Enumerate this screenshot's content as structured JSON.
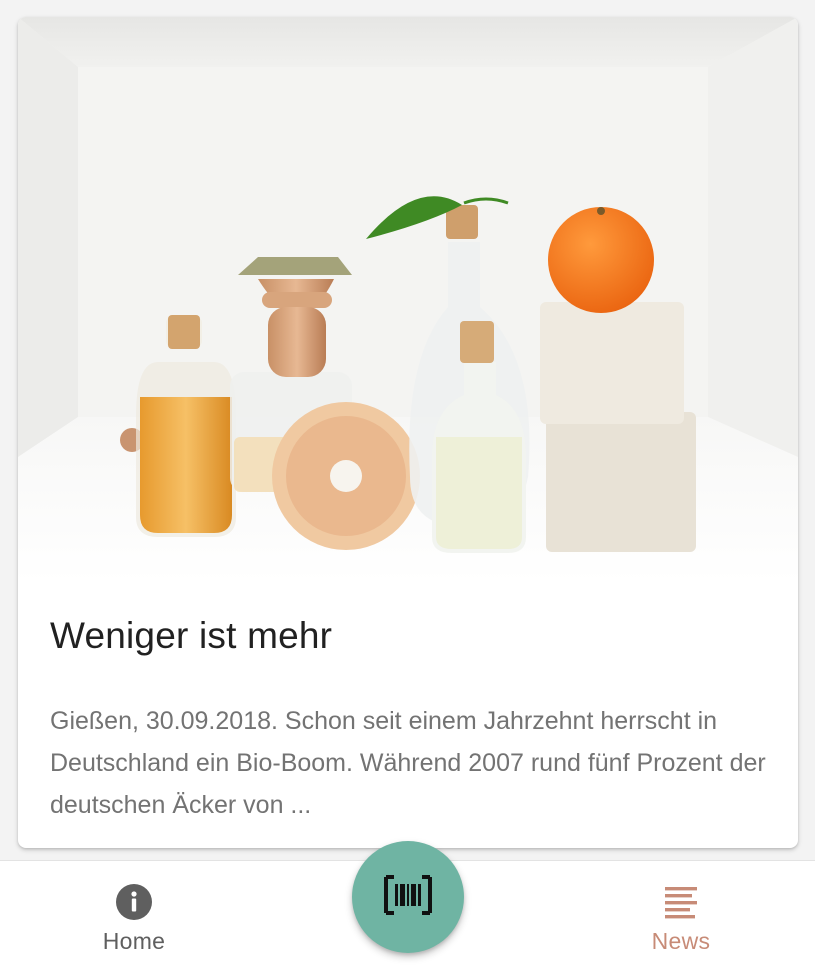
{
  "article": {
    "image_alt": "Glasflaschen mit Öl, Holzbürsten, Seifenblöcke und eine Mandarine in einem weißen Regal",
    "title": "Weniger ist mehr",
    "excerpt": "Gießen, 30.09.2018. Schon seit einem Jahrzehnt herrscht in Deutschland ein Bio-Boom. Während 2007 rund fünf Prozent der deutschen Äcker von ..."
  },
  "bottom_nav": {
    "items": [
      {
        "label": "Home",
        "icon": "info-icon",
        "active": false
      },
      {
        "label": "News",
        "icon": "news-list-icon",
        "active": true
      }
    ],
    "scan_button_icon": "barcode-scan-icon"
  },
  "colors": {
    "accent": "#6fb4a3",
    "active_nav": "#c78b77",
    "inactive_nav": "#5f5f5f"
  }
}
